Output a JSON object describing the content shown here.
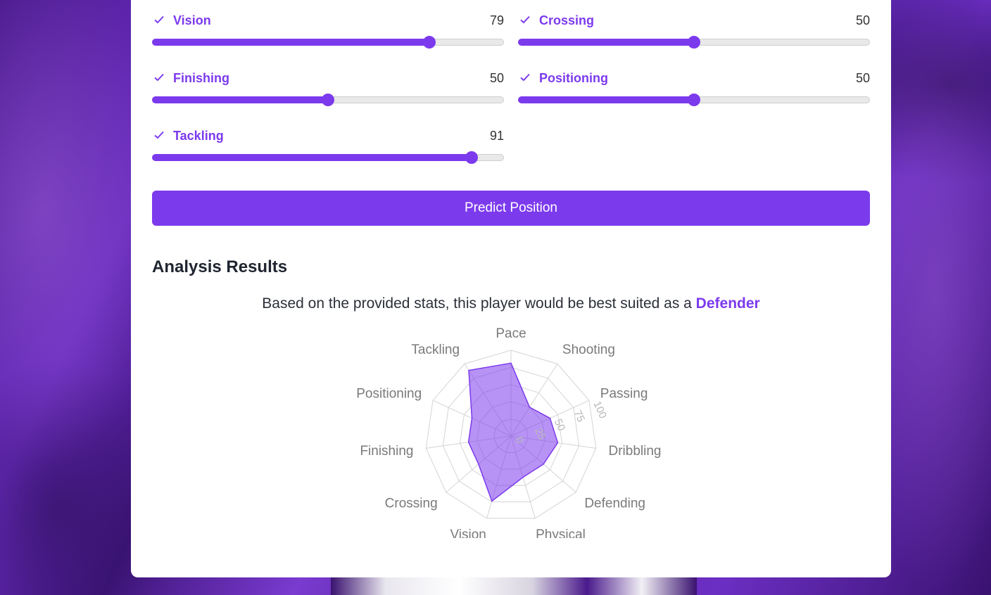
{
  "sliders": [
    {
      "label": "Vision",
      "value": "79",
      "pct": 79
    },
    {
      "label": "Crossing",
      "value": "50",
      "pct": 50
    },
    {
      "label": "Finishing",
      "value": "50",
      "pct": 50
    },
    {
      "label": "Positioning",
      "value": "50",
      "pct": 50
    },
    {
      "label": "Tackling",
      "value": "91",
      "pct": 91
    }
  ],
  "predict_button": "Predict Position",
  "results": {
    "title": "Analysis Results",
    "text": "Based on the provided stats, this player would be best suited as a ",
    "position": "Defender"
  },
  "colors": {
    "accent": "#7c3aed",
    "radar_fill": "rgba(124,58,237,0.55)"
  },
  "chart_data": {
    "type": "radar",
    "categories": [
      "Pace",
      "Shooting",
      "Passing",
      "Dribbling",
      "Defending",
      "Physical",
      "Vision",
      "Crossing",
      "Finishing",
      "Positioning",
      "Tackling"
    ],
    "values": [
      85,
      40,
      50,
      55,
      50,
      50,
      79,
      50,
      50,
      50,
      91
    ],
    "scale": {
      "min": 0,
      "max": 100,
      "ticks": [
        "0",
        "25",
        "50",
        "75",
        "100"
      ]
    }
  }
}
